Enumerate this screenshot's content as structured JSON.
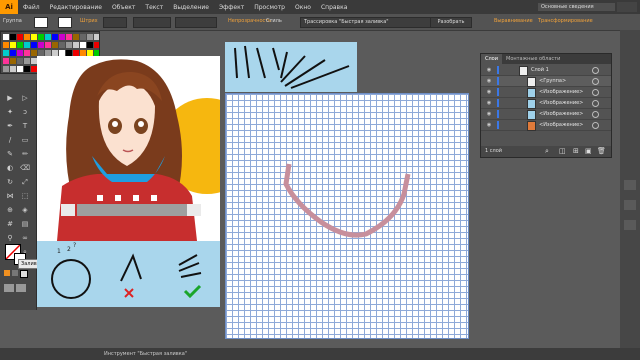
{
  "app": {
    "logo": "Ai",
    "workspace": "Основные сведения"
  },
  "menu": [
    "Файл",
    "Редактирование",
    "Объект",
    "Текст",
    "Выделение",
    "Эффект",
    "Просмотр",
    "Окно",
    "Справка"
  ],
  "controlbar": {
    "left_label": "Группа",
    "stroke_label": "Штрих",
    "opacity_label": "Непрозрачность",
    "style_label": "Стиль",
    "trace_preset": "Трассировка \"Быстрая заливка\"",
    "expand_label": "Разобрать",
    "align_label": "Выравнивание",
    "transform_label": "Трансформирование"
  },
  "colors": {
    "accent": "#f1a23a",
    "grid": "#8ea9d8",
    "panel_blue": "#a9d6ec",
    "stroke_path": "#c78f9c",
    "selection": "#3b78e7"
  },
  "tools_tooltip": "Заливка (X)",
  "tool_numbers": [
    "1",
    "2",
    "?"
  ],
  "layers_panel": {
    "tabs": [
      "Слои",
      "Монтажные области"
    ],
    "rows": [
      {
        "name": "Слой 1",
        "level": 0
      },
      {
        "name": "<Группа>",
        "level": 1
      },
      {
        "name": "<Изображение>",
        "level": 1
      },
      {
        "name": "<Изображение>",
        "level": 1
      },
      {
        "name": "<Изображение>",
        "level": 1
      },
      {
        "name": "<Изображение>",
        "level": 1
      }
    ],
    "footer": "1 слой"
  },
  "status": {
    "tool": "Инструмент \"Быстрая заливка\""
  }
}
